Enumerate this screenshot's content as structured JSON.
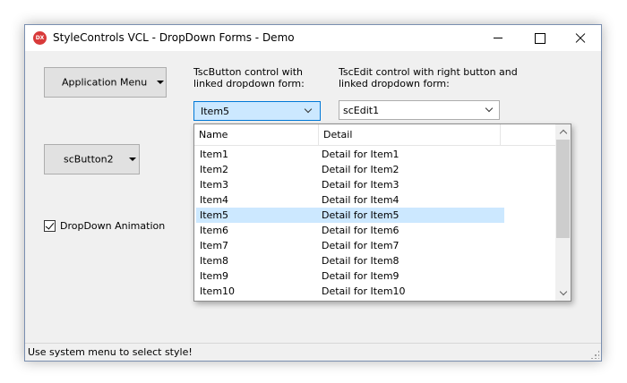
{
  "window": {
    "title": "StyleControls VCL - DropDown Forms - Demo",
    "app_icon": "DX"
  },
  "buttons": {
    "app_menu_label": "Application Menu",
    "sc_button2_label": "scButton2"
  },
  "labels": {
    "tsc_button_desc": "TscButton control with linked dropdown form:",
    "sc_edit_desc": "TscEdit control with right button and linked dropdown form:"
  },
  "combo": {
    "value": "Item5"
  },
  "edit": {
    "value": "scEdit1"
  },
  "checkbox": {
    "label": "DropDown Animation",
    "checked": true
  },
  "dropdown": {
    "columns": [
      "Name",
      "Detail"
    ],
    "rows": [
      {
        "name": "Item1",
        "detail": "Detail for Item1"
      },
      {
        "name": "Item2",
        "detail": "Detail for Item2"
      },
      {
        "name": "Item3",
        "detail": "Detail for Item3"
      },
      {
        "name": "Item4",
        "detail": "Detail for Item4"
      },
      {
        "name": "Item5",
        "detail": "Detail for Item5",
        "selected": true
      },
      {
        "name": "Item6",
        "detail": "Detail for Item6"
      },
      {
        "name": "Item7",
        "detail": "Detail for Item7"
      },
      {
        "name": "Item8",
        "detail": "Detail for Item8"
      },
      {
        "name": "Item9",
        "detail": "Detail for Item9"
      },
      {
        "name": "Item10",
        "detail": "Detail for Item10"
      }
    ]
  },
  "status": {
    "text": "Use system menu to select style!"
  }
}
